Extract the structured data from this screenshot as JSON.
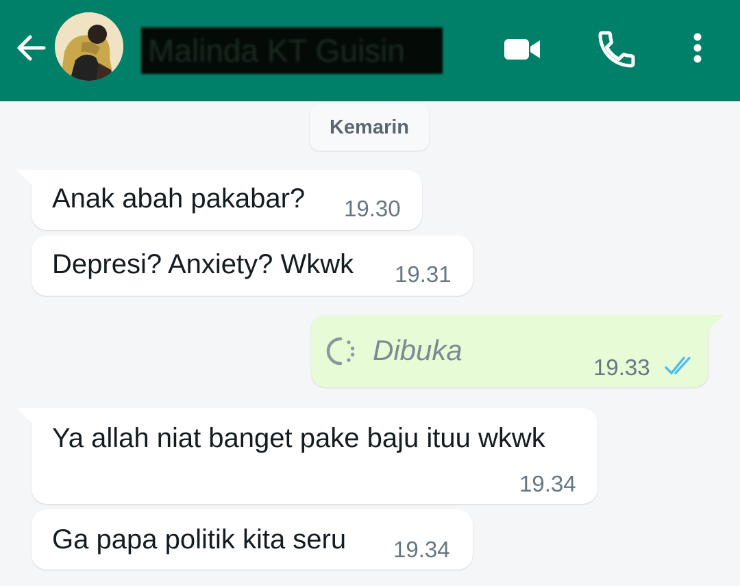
{
  "header": {
    "contact_name": "Malinda KT Guisin",
    "back_icon": "arrow-left-icon",
    "video_icon": "video-camera-icon",
    "call_icon": "phone-icon",
    "menu_icon": "more-vertical-icon",
    "bg_color": "#008069"
  },
  "chat": {
    "date_separator": "Kemarin",
    "messages": [
      {
        "direction": "in",
        "text": "Anak abah pakabar?",
        "time": "19.30"
      },
      {
        "direction": "in",
        "text": "Depresi? Anxiety? Wkwk",
        "time": "19.31"
      },
      {
        "direction": "out",
        "text": "Dibuka",
        "time": "19.33",
        "status": "read"
      },
      {
        "direction": "in",
        "text": "Ya allah niat banget pake baju ituu wkwk",
        "time": "19.34"
      },
      {
        "direction": "in",
        "text": "Ga papa politik kita seru",
        "time": "19.34"
      }
    ]
  },
  "colors": {
    "outgoing_bubble": "#e7fbd7",
    "incoming_bubble": "#ffffff",
    "read_ticks": "#53bdeb",
    "chat_background": "#f5f6f8"
  }
}
